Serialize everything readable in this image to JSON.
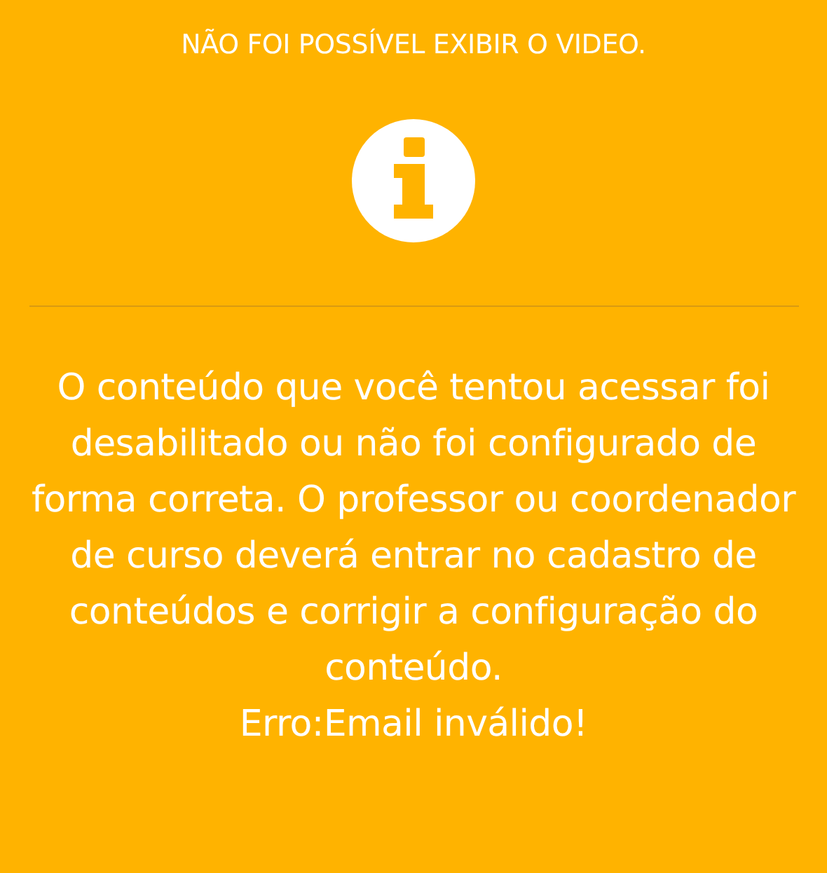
{
  "title": "NÃO FOI POSSÍVEL EXIBIR O VIDEO.",
  "message": "O conteúdo que você tentou acessar foi desabilitado ou não foi configurado de forma correta. O professor ou coordenador de curso deverá entrar no cadastro de conteúdos e corrigir a configuração do conteúdo.",
  "error": "Erro:Email inválido!"
}
